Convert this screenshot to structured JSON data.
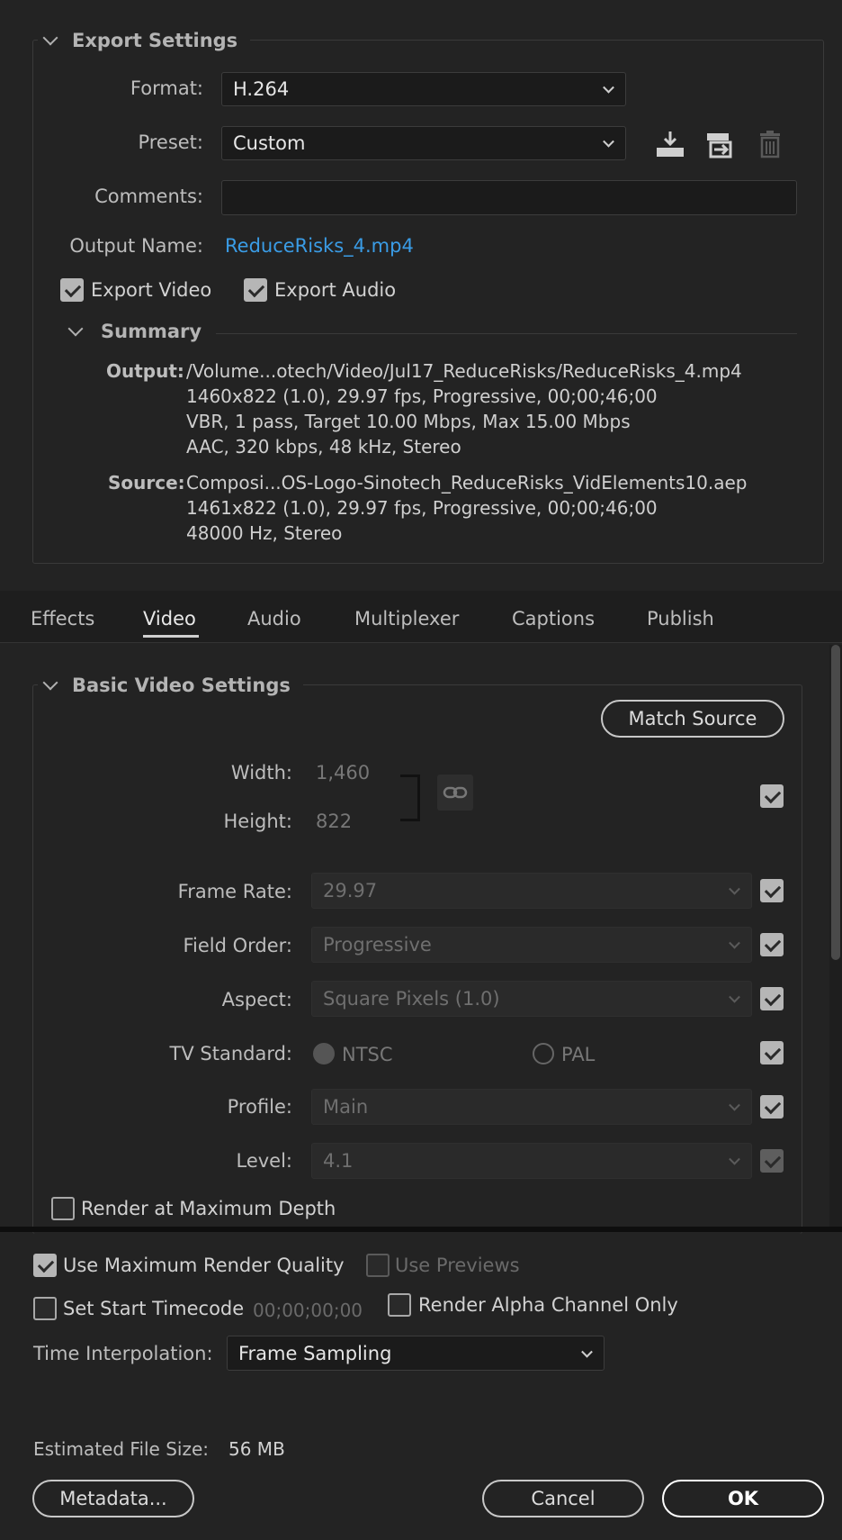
{
  "export_settings": {
    "title": "Export Settings",
    "format_label": "Format:",
    "format_value": "H.264",
    "preset_label": "Preset:",
    "preset_value": "Custom",
    "comments_label": "Comments:",
    "comments_value": "",
    "output_name_label": "Output Name:",
    "output_name_value": "ReduceRisks_4.mp4",
    "export_video_label": "Export Video",
    "export_video_checked": true,
    "export_audio_label": "Export Audio",
    "export_audio_checked": true,
    "preset_icons": [
      "save-preset-icon",
      "import-preset-icon",
      "delete-preset-icon"
    ]
  },
  "summary": {
    "title": "Summary",
    "output_label": "Output:",
    "output_lines": [
      "/Volume...otech/Video/Jul17_ReduceRisks/ReduceRisks_4.mp4",
      "1460x822 (1.0), 29.97 fps, Progressive, 00;00;46;00",
      "VBR, 1 pass, Target 10.00 Mbps, Max 15.00 Mbps",
      "AAC, 320 kbps, 48 kHz, Stereo"
    ],
    "source_label": "Source:",
    "source_lines": [
      "Composi...OS-Logo-Sinotech_ReduceRisks_VidElements10.aep",
      "1461x822 (1.0), 29.97 fps, Progressive, 00;00;46;00",
      "48000 Hz, Stereo"
    ]
  },
  "tabs": [
    {
      "label": "Effects",
      "active": false
    },
    {
      "label": "Video",
      "active": true
    },
    {
      "label": "Audio",
      "active": false
    },
    {
      "label": "Multiplexer",
      "active": false
    },
    {
      "label": "Captions",
      "active": false
    },
    {
      "label": "Publish",
      "active": false
    }
  ],
  "basic_video": {
    "title": "Basic Video Settings",
    "match_source_label": "Match Source",
    "width_label": "Width:",
    "width_value": "1,460",
    "height_label": "Height:",
    "height_value": "822",
    "frame_rate_label": "Frame Rate:",
    "frame_rate_value": "29.97",
    "field_order_label": "Field Order:",
    "field_order_value": "Progressive",
    "aspect_label": "Aspect:",
    "aspect_value": "Square Pixels (1.0)",
    "tv_standard_label": "TV Standard:",
    "ntsc_label": "NTSC",
    "pal_label": "PAL",
    "profile_label": "Profile:",
    "profile_value": "Main",
    "level_label": "Level:",
    "level_value": "4.1",
    "render_max_depth_label": "Render at Maximum Depth"
  },
  "bottom": {
    "use_max_render_quality_label": "Use Maximum Render Quality",
    "use_previews_label": "Use Previews",
    "set_start_timecode_label": "Set Start Timecode",
    "start_timecode_value": "00;00;00;00",
    "render_alpha_label": "Render Alpha Channel Only",
    "time_interpolation_label": "Time Interpolation:",
    "time_interpolation_value": "Frame Sampling",
    "estimated_file_size_label": "Estimated File Size:",
    "estimated_file_size_value": "56 MB",
    "metadata_label": "Metadata...",
    "cancel_label": "Cancel",
    "ok_label": "OK"
  }
}
